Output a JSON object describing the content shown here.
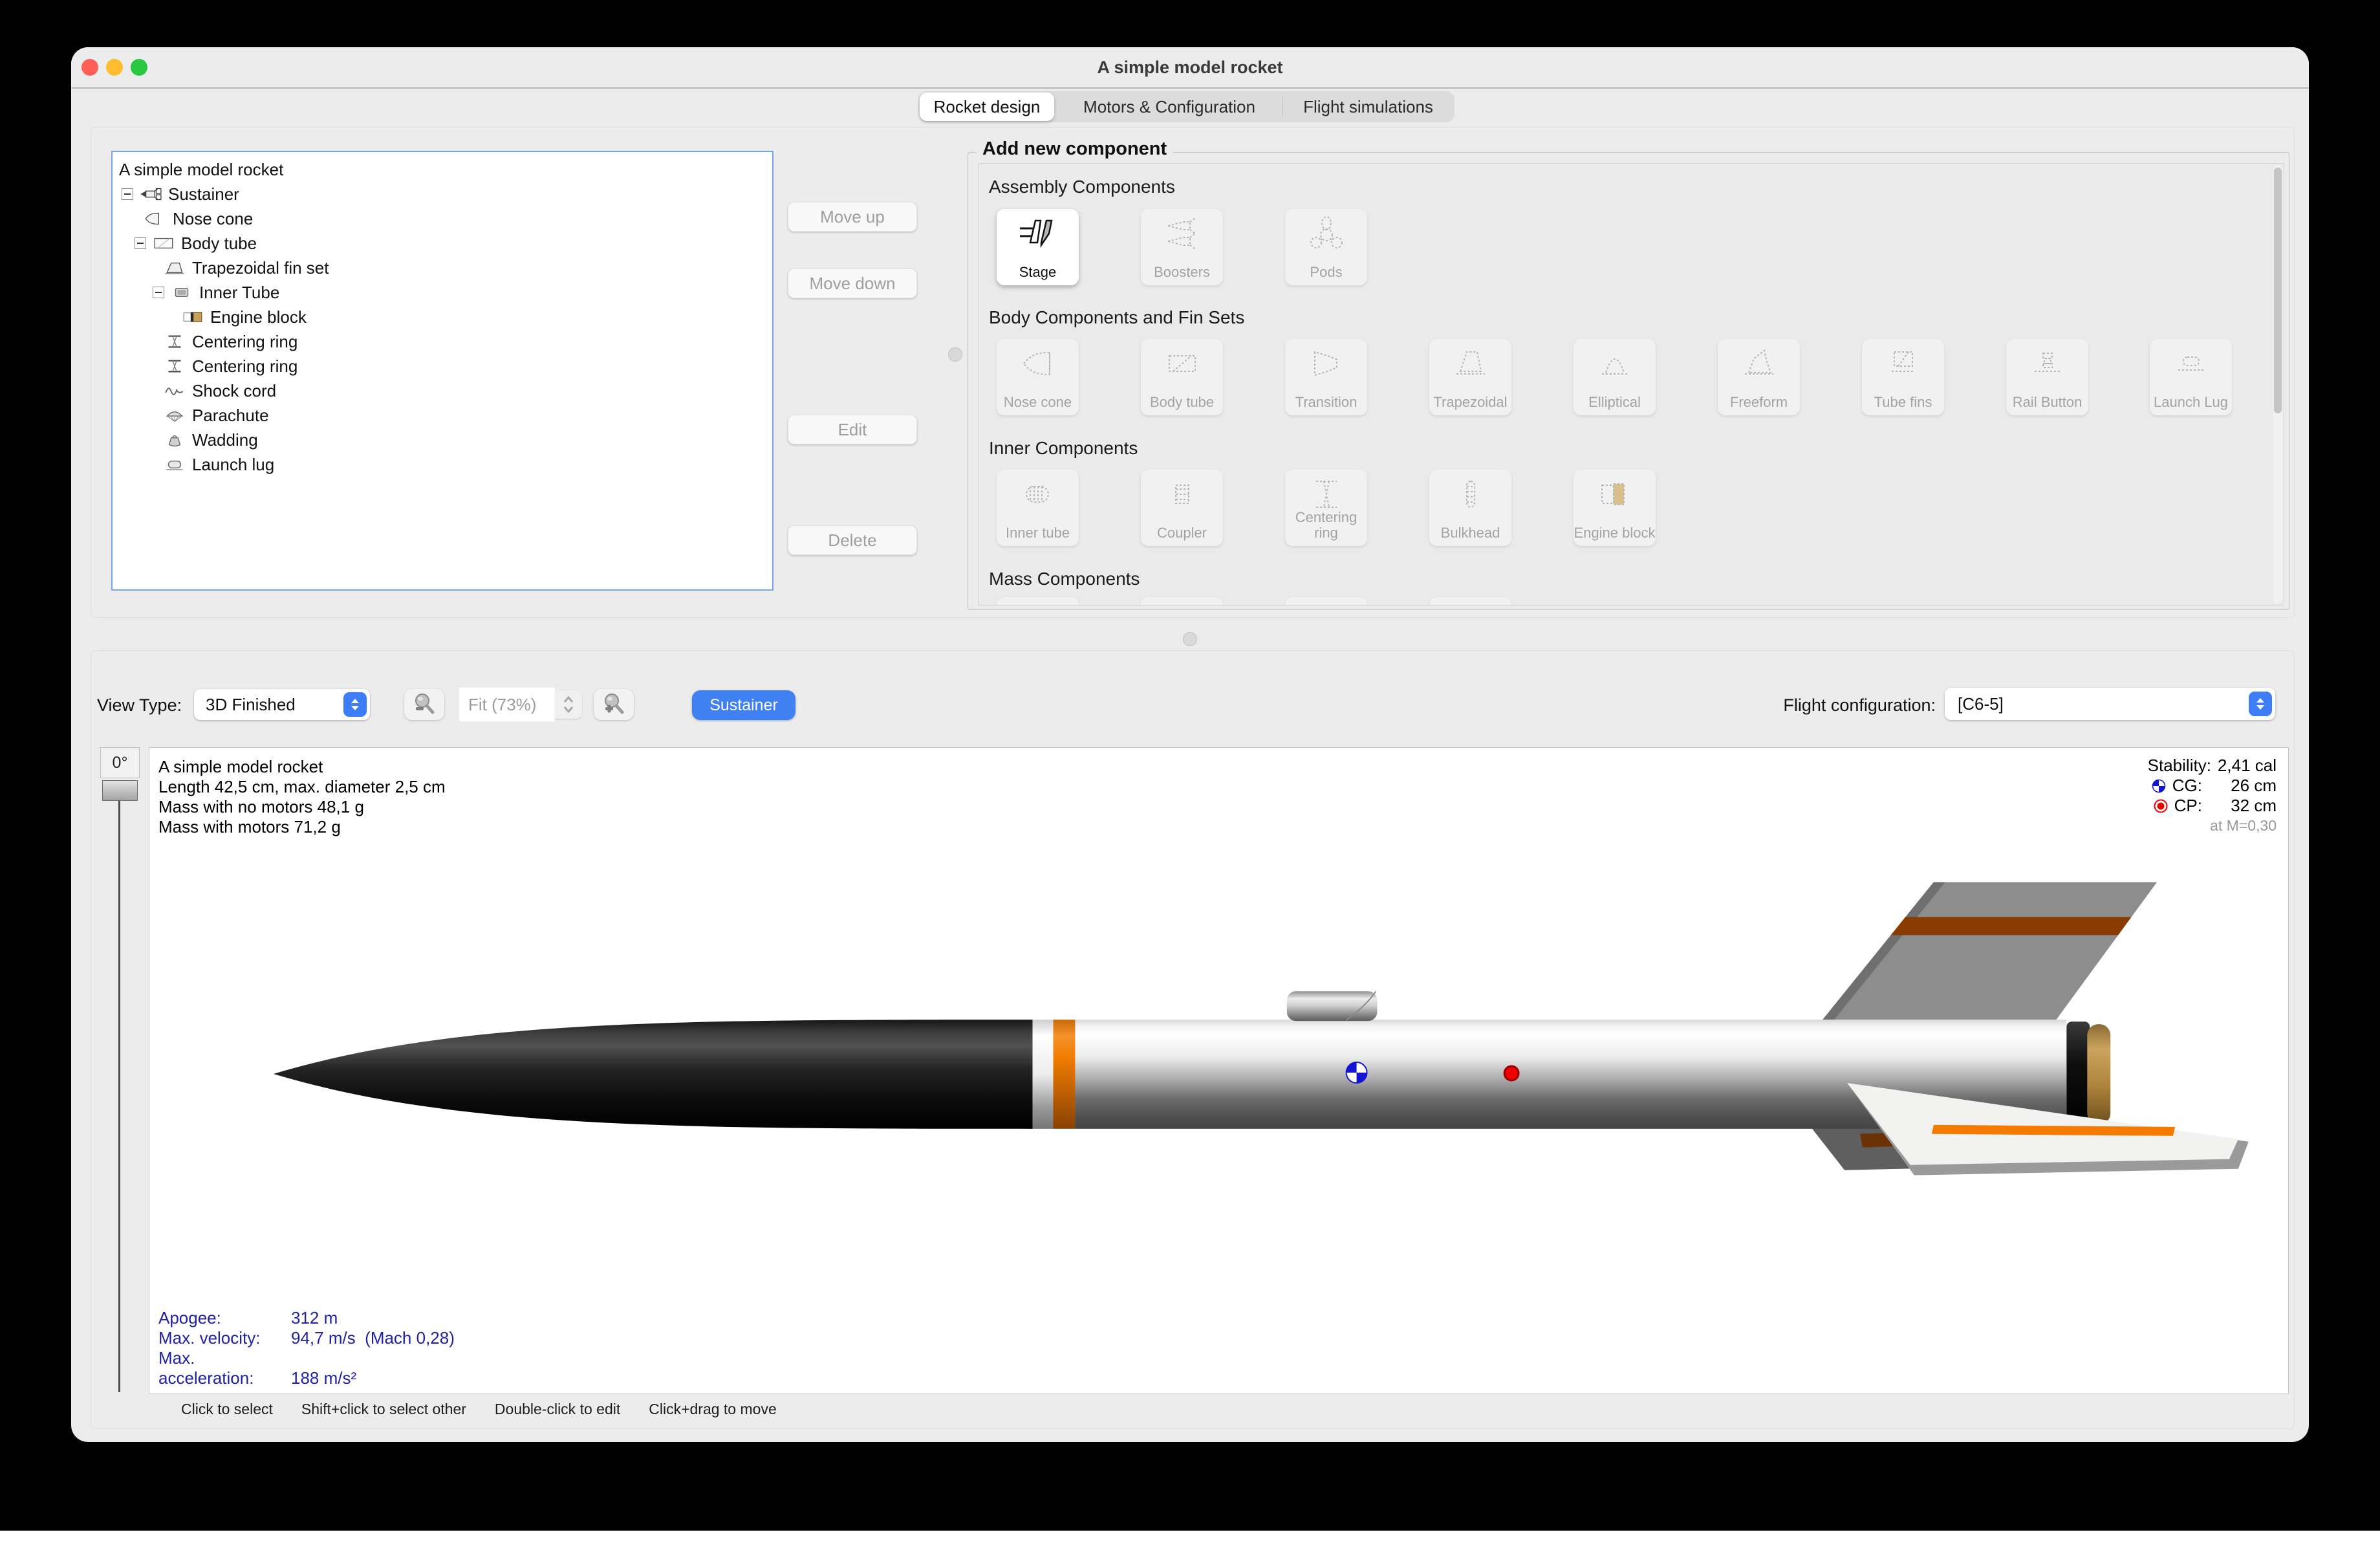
{
  "window": {
    "title": "A simple model rocket"
  },
  "tabs": {
    "items": [
      {
        "label": "Rocket design"
      },
      {
        "label": "Motors & Configuration"
      },
      {
        "label": "Flight simulations"
      }
    ]
  },
  "tree": {
    "items": [
      {
        "label": "A simple model rocket"
      },
      {
        "label": "Sustainer"
      },
      {
        "label": "Nose cone"
      },
      {
        "label": "Body tube"
      },
      {
        "label": "Trapezoidal fin set"
      },
      {
        "label": "Inner Tube"
      },
      {
        "label": "Engine block"
      },
      {
        "label": "Centering ring"
      },
      {
        "label": "Centering ring"
      },
      {
        "label": "Shock cord"
      },
      {
        "label": "Parachute"
      },
      {
        "label": "Wadding"
      },
      {
        "label": "Launch lug"
      }
    ]
  },
  "actions": {
    "move_up": "Move up",
    "move_down": "Move down",
    "edit": "Edit",
    "delete": "Delete"
  },
  "add_component": {
    "title": "Add new component",
    "sections": [
      {
        "label": "Assembly Components",
        "items": [
          {
            "label": "Stage"
          },
          {
            "label": "Boosters"
          },
          {
            "label": "Pods"
          }
        ]
      },
      {
        "label": "Body Components and Fin Sets",
        "items": [
          {
            "label": "Nose cone"
          },
          {
            "label": "Body tube"
          },
          {
            "label": "Transition"
          },
          {
            "label": "Trapezoidal"
          },
          {
            "label": "Elliptical"
          },
          {
            "label": "Freeform"
          },
          {
            "label": "Tube fins"
          },
          {
            "label": "Rail Button"
          },
          {
            "label": "Launch Lug"
          }
        ]
      },
      {
        "label": "Inner Components",
        "items": [
          {
            "label": "Inner tube"
          },
          {
            "label": "Coupler"
          },
          {
            "label": "Centering ring"
          },
          {
            "label": "Bulkhead"
          },
          {
            "label": "Engine block"
          }
        ]
      },
      {
        "label": "Mass Components",
        "items": []
      }
    ]
  },
  "view_controls": {
    "view_type_label": "View Type:",
    "view_type_value": "3D Finished",
    "zoom_value": "Fit (73%)",
    "stage_button": "Sustainer",
    "flight_config_label": "Flight configuration:",
    "flight_config_value": "[C6-5]"
  },
  "rotation": {
    "angle": "0°"
  },
  "canvas": {
    "info": {
      "name": "A simple model rocket",
      "line2": "Length 42,5 cm, max. diameter 2,5 cm",
      "line3": "Mass with no motors 48,1 g",
      "line4": "Mass with motors 71,2 g"
    },
    "stability": {
      "label": "Stability:",
      "value": "2,41 cal",
      "cg_label": "CG:",
      "cg_value": "26 cm",
      "cp_label": "CP:",
      "cp_value": "32 cm",
      "note": "at M=0,30"
    },
    "flight": {
      "rows": [
        {
          "label": "Apogee:",
          "value": "312 m"
        },
        {
          "label": "Max. velocity:",
          "value": "94,7 m/s  (Mach 0,28)"
        },
        {
          "label": "Max. acceleration:",
          "value": "188 m/s²"
        }
      ]
    },
    "hints": [
      {
        "t": "Click to select"
      },
      {
        "t": "Shift+click to select other"
      },
      {
        "t": "Double-click to edit"
      },
      {
        "t": "Click+drag to move"
      }
    ]
  },
  "colors": {
    "accent": "#3d7df7",
    "cg_marker": "#1414d4",
    "cp_marker": "#ee0000",
    "flight_text": "#2121a3"
  }
}
